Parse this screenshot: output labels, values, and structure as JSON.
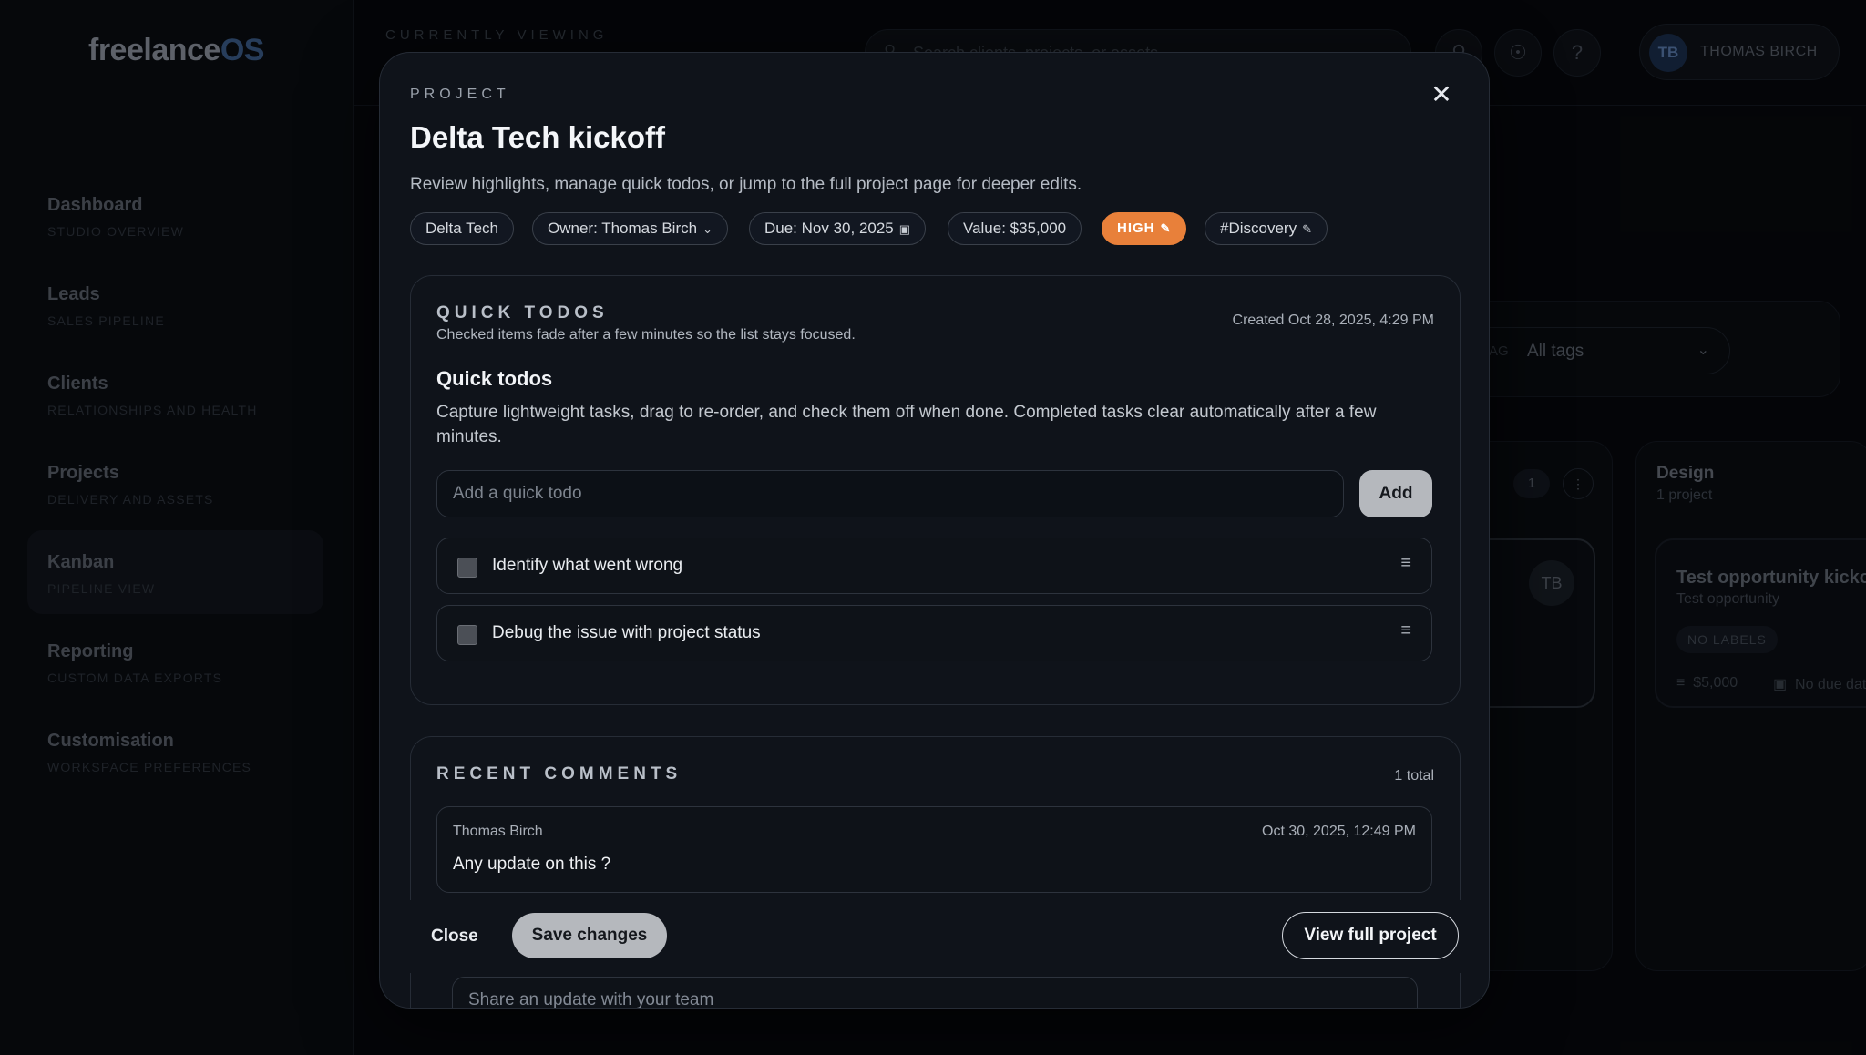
{
  "sidebar": {
    "logo_main": "freelance",
    "logo_accent": "OS",
    "items": [
      {
        "label": "Dashboard",
        "sub": "STUDIO OVERVIEW"
      },
      {
        "label": "Leads",
        "sub": "SALES PIPELINE"
      },
      {
        "label": "Clients",
        "sub": "RELATIONSHIPS AND HEALTH"
      },
      {
        "label": "Projects",
        "sub": "DELIVERY AND ASSETS"
      },
      {
        "label": "Kanban",
        "sub": "PIPELINE VIEW"
      },
      {
        "label": "Reporting",
        "sub": "CUSTOM DATA EXPORTS"
      },
      {
        "label": "Customisation",
        "sub": "WORKSPACE PREFERENCES"
      }
    ]
  },
  "topbar": {
    "currently_viewing": "CURRENTLY VIEWING",
    "search_placeholder": "Search clients, projects, or assets",
    "user_initials": "TB",
    "user_name": "THOMAS BIRCH"
  },
  "filters": {
    "tag_label": "TAG",
    "tag_value": "All tags"
  },
  "kanban": {
    "column_count": "1",
    "card_initials": "TB",
    "design_column": {
      "title": "Design",
      "sub": "1 project"
    },
    "opportunity_card": {
      "title": "Test opportunity kickoff",
      "sub": "Test opportunity",
      "badge": "NO LABELS",
      "value": "$5,000",
      "due": "No due date"
    }
  },
  "modal": {
    "eyebrow": "PROJECT",
    "title": "Delta Tech kickoff",
    "description": "Review highlights, manage quick todos, or jump to the full project page for deeper edits.",
    "chips": {
      "client": "Delta Tech",
      "owner": "Owner: Thomas Birch",
      "due": "Due: Nov 30, 2025",
      "value": "Value: $35,000",
      "priority": "HIGH",
      "tag": "#Discovery"
    },
    "todos": {
      "eyebrow": "QUICK TODOS",
      "note": "Checked items fade after a few minutes so the list stays focused.",
      "created": "Created Oct 28, 2025, 4:29 PM",
      "heading": "Quick todos",
      "text": "Capture lightweight tasks, drag to re-order, and check them off when done. Completed tasks clear automatically after a few minutes.",
      "input_placeholder": "Add a quick todo",
      "add_label": "Add",
      "items": [
        {
          "text": "Identify what went wrong"
        },
        {
          "text": "Debug the issue with project status"
        }
      ]
    },
    "comments": {
      "eyebrow": "RECENT COMMENTS",
      "total": "1 total",
      "items": [
        {
          "author": "Thomas Birch",
          "time": "Oct 30, 2025, 12:49 PM",
          "body": "Any update on this ?"
        }
      ],
      "reply_placeholder": "Share an update with your team"
    },
    "footer": {
      "close_label": "Close",
      "save_label": "Save changes",
      "view_label": "View full project"
    }
  }
}
